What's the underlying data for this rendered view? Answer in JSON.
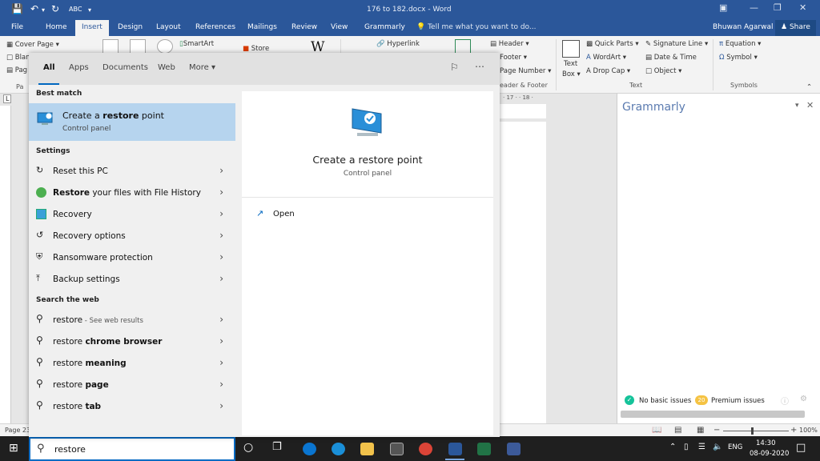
{
  "window": {
    "title": "176 to 182.docx  -  Word",
    "controls": [
      "restore-down",
      "minimize",
      "maximize",
      "close"
    ]
  },
  "ribbon": {
    "tabs": [
      {
        "label": "File"
      },
      {
        "label": "Home"
      },
      {
        "label": "Insert",
        "active": true
      },
      {
        "label": "Design"
      },
      {
        "label": "Layout"
      },
      {
        "label": "References"
      },
      {
        "label": "Mailings"
      },
      {
        "label": "Review"
      },
      {
        "label": "View"
      },
      {
        "label": "Grammarly"
      }
    ],
    "tell_me": "Tell me what you want to do...",
    "user": "Bhuwan Agarwal",
    "share": "Share",
    "items": {
      "cover_page": "Cover Page",
      "blank": "Blan",
      "page_break": "Pag",
      "pages_group": "Pa",
      "smartart": "SmartArt",
      "store": "Store",
      "hyperlink": "Hyperlink",
      "header": "Header",
      "footer": "Footer",
      "page_number": "Page Number",
      "header_footer_group": "eader & Footer",
      "text_box_1": "Text",
      "text_box_2": "Box",
      "quick_parts": "Quick Parts",
      "wordart": "WordArt",
      "drop_cap": "Drop Cap",
      "signature_line": "Signature Line",
      "date_time": "Date & Time",
      "object": "Object",
      "text_group": "Text",
      "equation": "Equation",
      "symbol": "Symbol",
      "symbols_group": "Symbols"
    }
  },
  "ruler_text": "· 17 · · 18 ·",
  "grammarly": {
    "title": "Grammarly",
    "no_basic": "No basic issues",
    "premium_count": "20",
    "premium": "Premium issues"
  },
  "status": {
    "page": "Page 23",
    "zoom": "100%"
  },
  "search": {
    "tabs": [
      {
        "label": "All",
        "active": true
      },
      {
        "label": "Apps"
      },
      {
        "label": "Documents"
      },
      {
        "label": "Web"
      },
      {
        "label": "More"
      }
    ],
    "best_match_heading": "Best match",
    "best_match": {
      "title_pre": "Create a ",
      "title_bold": "restore",
      "title_post": " point",
      "subtitle": "Control panel"
    },
    "settings_heading": "Settings",
    "settings": [
      {
        "pre": "Reset this PC",
        "bold": "",
        "post": "",
        "icon": "reset-pc-icon"
      },
      {
        "pre": "",
        "bold": "Restore",
        "post": " your files with File History",
        "icon": "file-history-icon"
      },
      {
        "pre": "Recovery",
        "bold": "",
        "post": "",
        "icon": "recovery-icon"
      },
      {
        "pre": "Recovery options",
        "bold": "",
        "post": "",
        "icon": "recovery-options-icon"
      },
      {
        "pre": "Ransomware protection",
        "bold": "",
        "post": "",
        "icon": "shield-icon"
      },
      {
        "pre": "Backup settings",
        "bold": "",
        "post": "",
        "icon": "backup-icon"
      }
    ],
    "web_heading": "Search the web",
    "web": [
      {
        "pre": "restore",
        "bold": "",
        "sub": " - See web results"
      },
      {
        "pre": "restore ",
        "bold": "chrome browser",
        "sub": ""
      },
      {
        "pre": "restore ",
        "bold": "meaning",
        "sub": ""
      },
      {
        "pre": "restore ",
        "bold": "page",
        "sub": ""
      },
      {
        "pre": "restore ",
        "bold": "tab",
        "sub": ""
      }
    ],
    "preview": {
      "title": "Create a restore point",
      "subtitle": "Control panel",
      "action": "Open"
    },
    "query": "restore"
  },
  "taskbar": {
    "tray_lang": "ENG",
    "time": "14:30",
    "date": "08-09-2020"
  },
  "colors": {
    "word_blue": "#2b579a",
    "highlight": "#b6d4ee",
    "accent": "#0067c0"
  }
}
